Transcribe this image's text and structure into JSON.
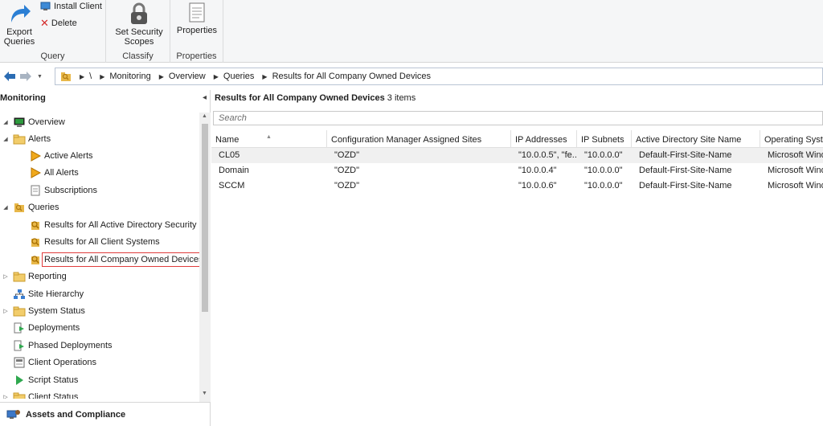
{
  "ribbon": {
    "export_queries": "Export\nQueries",
    "install_client": "Install Client",
    "delete": "Delete",
    "set_security_scopes": "Set Security\nScopes",
    "properties": "Properties",
    "groups": {
      "query": "Query",
      "classify": "Classify",
      "properties": "Properties"
    }
  },
  "address_bar": {
    "root": "\\",
    "crumbs": [
      "Monitoring",
      "Overview",
      "Queries",
      "Results for All Company Owned Devices"
    ]
  },
  "left_pane": {
    "title": "Monitoring",
    "tree": [
      {
        "label": "Overview"
      },
      {
        "label": "Alerts"
      },
      {
        "label": "Active Alerts"
      },
      {
        "label": "All Alerts"
      },
      {
        "label": "Subscriptions"
      },
      {
        "label": "Queries"
      },
      {
        "label": "Results for All Active Directory Security G"
      },
      {
        "label": "Results for All Client Systems"
      },
      {
        "label": "Results for All Company Owned Devices"
      },
      {
        "label": "Reporting"
      },
      {
        "label": "Site Hierarchy"
      },
      {
        "label": "System Status"
      },
      {
        "label": "Deployments"
      },
      {
        "label": "Phased Deployments"
      },
      {
        "label": "Client Operations"
      },
      {
        "label": "Script Status"
      },
      {
        "label": "Client Status"
      }
    ],
    "workspace": "Assets and Compliance"
  },
  "right_pane": {
    "title": "Results for All Company Owned Devices",
    "count": "3 items",
    "search_placeholder": "Search",
    "columns": [
      "Name",
      "Configuration Manager Assigned Sites",
      "IP Addresses",
      "IP Subnets",
      "Active Directory Site Name",
      "Operating Syste"
    ],
    "rows": [
      [
        "CL05",
        "\"OZD\"",
        "\"10.0.0.5\", \"fe...",
        "\"10.0.0.0\"",
        "Default-First-Site-Name",
        "Microsoft Wind"
      ],
      [
        "Domain",
        "\"OZD\"",
        "\"10.0.0.4\"",
        "\"10.0.0.0\"",
        "Default-First-Site-Name",
        "Microsoft Wind"
      ],
      [
        "SCCM",
        "\"OZD\"",
        "\"10.0.0.6\"",
        "\"10.0.0.0\"",
        "Default-First-Site-Name",
        "Microsoft Wind"
      ]
    ]
  },
  "colors": {
    "accent": "#1e73be",
    "folder": "#e8b84a",
    "selection_outline": "#e03c3c",
    "row_highlight": "#f0f0f0"
  }
}
